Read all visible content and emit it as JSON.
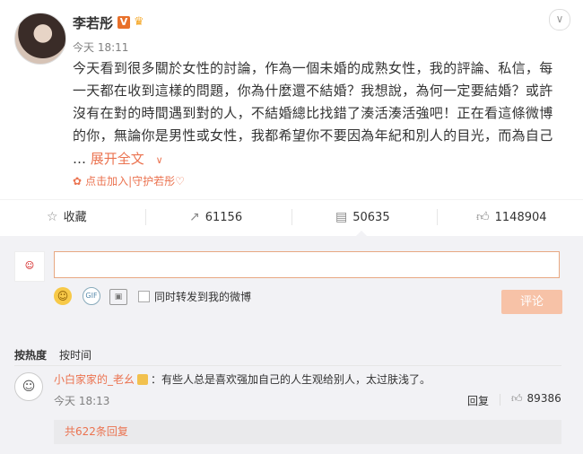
{
  "post": {
    "author": "李若彤",
    "time": "今天 18:11",
    "content": "今天看到很多關於女性的討論，作為一個未婚的成熟女性，我的評論、私信，每一天都在收到這樣的問題，你為什麼還不結婚？我想說，為何一定要結婚？或許沒有在對的時間遇到對的人，不結婚總比找錯了湊活湊活強吧！正在看這條微博的你，無論你是男性或女性，我都希望你不要因為年紀和別人的目光，而為自己",
    "ellipsis": "…",
    "expand_label": "展开全文",
    "join_label": "点击加入|守护若彤♡"
  },
  "actions": {
    "favorite_label": "收藏",
    "repost_count": "61156",
    "comment_count": "50635",
    "like_count": "1148904"
  },
  "composer": {
    "placeholder": "",
    "sync_label": "同时转发到我的微博",
    "submit_label": "评论"
  },
  "sort": {
    "by_hot": "按热度",
    "by_time": "按时间"
  },
  "comment": {
    "user": "小白家家的_老幺",
    "text": "：有些人总是喜欢强加自己的人生观给别人，太过肤浅了。",
    "time": "今天 18:13",
    "reply_label": "回复",
    "like_count": "89386",
    "replies_label": "共622条回复"
  },
  "colors": {
    "accent": "#eb7350",
    "submit_disabled": "#f7c2a7",
    "panel_bg": "#f2f2f5"
  },
  "icons": {
    "favorite": "star-icon",
    "repost": "repost-icon",
    "comment": "comment-icon",
    "like": "thumbs-up-icon"
  }
}
